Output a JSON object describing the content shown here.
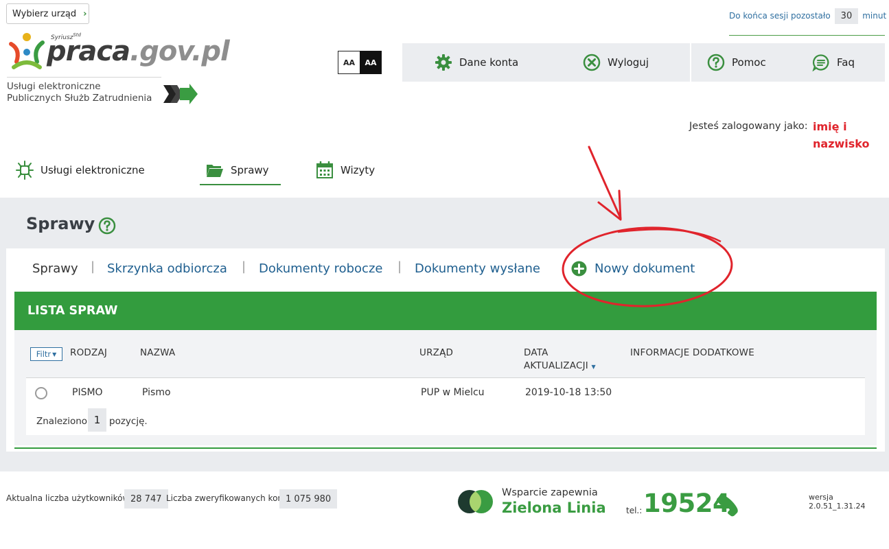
{
  "top": {
    "office_button": "Wybierz urząd",
    "session_label": "Do końca sesji pozostało",
    "session_minutes": "30",
    "session_unit": "minut"
  },
  "logo": {
    "small": "Syriusz",
    "small_sup": "Std",
    "praca": "praca",
    "gov": ".gov.pl",
    "sub_line1": "Usługi elektroniczne",
    "sub_line2": "Publicznych Służb Zatrudnienia"
  },
  "contrast": {
    "normal": "AA",
    "high": "AA"
  },
  "account_menu": {
    "items": [
      {
        "label": "Dane konta",
        "icon": "gear-icon"
      },
      {
        "label": "Wyloguj",
        "icon": "logout-icon"
      },
      {
        "label": "Pomoc",
        "icon": "help-icon"
      },
      {
        "label": "Faq",
        "icon": "chat-icon"
      }
    ]
  },
  "user": {
    "label": "Jesteś zalogowany jako:",
    "name_line1": "imię i",
    "name_line2": "nazwisko"
  },
  "nav": {
    "items": [
      {
        "label": "Usługi elektroniczne",
        "icon": "services-icon"
      },
      {
        "label": "Sprawy",
        "icon": "folder-icon",
        "active": true
      },
      {
        "label": "Wizyty",
        "icon": "calendar-icon"
      }
    ]
  },
  "page": {
    "title": "Sprawy"
  },
  "subnav": {
    "items": [
      {
        "label": "Sprawy"
      },
      {
        "label": "Skrzynka odbiorcza"
      },
      {
        "label": "Dokumenty robocze"
      },
      {
        "label": "Dokumenty wysłane"
      },
      {
        "label": "Nowy dokument",
        "icon": "plus-circle-icon"
      }
    ],
    "separator": "|"
  },
  "list": {
    "header": "LISTA SPRAW",
    "filter_label": "Filtr",
    "columns": [
      "RODZAJ",
      "NAZWA",
      "URZĄD",
      "DATA",
      "AKTUALIZACJI",
      "INFORMACJE DODATKOWE"
    ],
    "rows": [
      {
        "type": "PISMO",
        "name": "Pismo",
        "office": "PUP w Mielcu",
        "date": "2019-10-18 13:50",
        "info": ""
      }
    ],
    "found_prefix": "Znaleziono",
    "found_count": "1",
    "found_suffix": "pozycję."
  },
  "footer": {
    "users_label": "Aktualna liczba użytkowników:",
    "users_count": "28 747",
    "verified_label": "Liczba zweryfikowanych kont:",
    "verified_count": "1 075 980",
    "support_small": "Wsparcie zapewnia",
    "support_big": "Zielona Linia",
    "tel_label": "tel.:",
    "tel_number": "19524",
    "version": "wersja 2.0.51_1.31.24"
  },
  "colors": {
    "green": "#339c3e",
    "link_blue": "#1f5f8f",
    "annotation_red": "#e0242c",
    "panel_gray": "#eaecef"
  }
}
